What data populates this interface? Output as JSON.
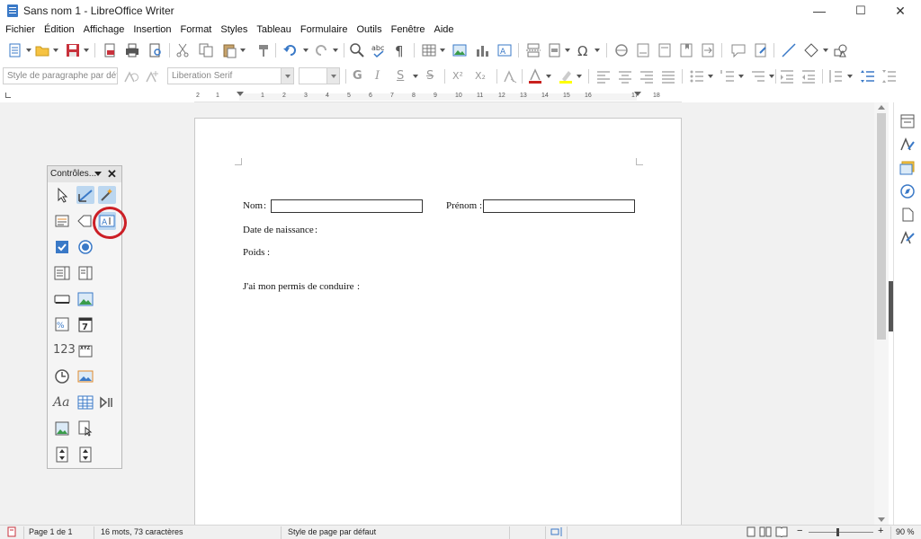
{
  "window": {
    "title": "Sans nom 1 - LibreOffice Writer",
    "minimize": "—",
    "maximize": "☐",
    "close": "✕"
  },
  "menu": [
    "Fichier",
    "Édition",
    "Affichage",
    "Insertion",
    "Format",
    "Styles",
    "Tableau",
    "Formulaire",
    "Outils",
    "Fenêtre",
    "Aide"
  ],
  "format_toolbar": {
    "paragraph_style": "Style de paragraphe par défa",
    "font_name": "Liberation Serif",
    "font_size": "",
    "bold": "G",
    "italic": "I",
    "underline": "S",
    "strike": "S",
    "superscript": "X²",
    "subscript": "X₂"
  },
  "ruler": {
    "labels": [
      "1",
      "2",
      "1",
      "2",
      "3",
      "4",
      "5",
      "6",
      "7",
      "8",
      "9",
      "10",
      "11",
      "12",
      "13",
      "14",
      "15",
      "16",
      "17",
      "18"
    ]
  },
  "controls_toolbar": {
    "title": "Contrôles...",
    "close": "✕",
    "numeric_label": "123",
    "text_label": "Aa"
  },
  "document": {
    "nom_label": "Nom",
    "colon1": ":",
    "prenom_label": "Prénom",
    "colon2": ":",
    "date_label": "Date de naissance",
    "colon3": ":",
    "poids_label": "Poids",
    "colon4": ":",
    "permis_label": "J'ai mon permis de conduire",
    "colon5": ":"
  },
  "statusbar": {
    "page": "Page 1 de 1",
    "words": "16 mots, 73 caractères",
    "page_style": "Style de page par défaut",
    "zoom_minus": "−",
    "zoom_plus": "+",
    "zoom": "90 %"
  },
  "colors": {
    "accent": "#3a79c7",
    "highlight_circle": "#cc1f26",
    "selected_control": "#bcd7f0"
  }
}
